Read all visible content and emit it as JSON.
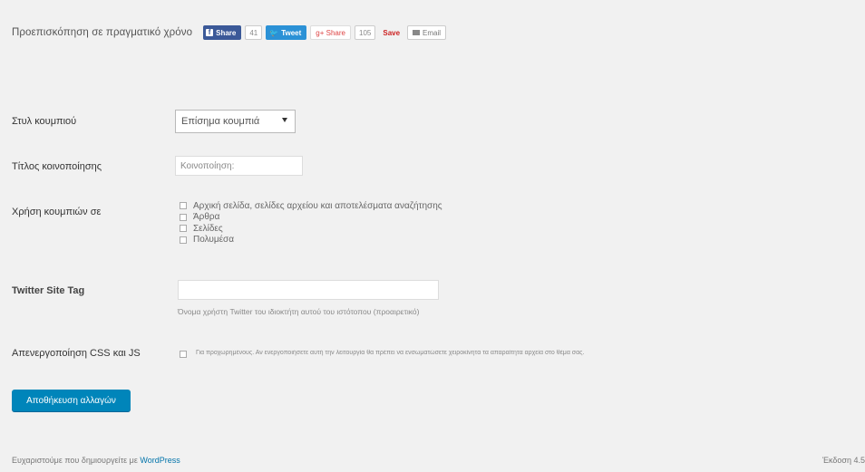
{
  "preview": {
    "label": "Προεπισκόπηση σε πραγματικό χρόνο",
    "buttons": {
      "facebook_label": "Share",
      "facebook_count": "41",
      "twitter_label": "Tweet",
      "gplus_label": "Share",
      "gplus_count": "105",
      "pinterest_label": "Save",
      "email_label": "Email"
    }
  },
  "fields": {
    "button_style": {
      "label": "Στυλ κουμπιού",
      "value": "Επίσημα κουμπιά"
    },
    "button_title": {
      "label": "Τίτλος κοινοποίησης",
      "value": "Κοινοποίηση:"
    },
    "button_usage": {
      "label": "Χρήση κουμπιών σε",
      "options": [
        "Αρχική σελίδα, σελίδες αρχείου και αποτελέσματα αναζήτησης",
        "Άρθρα",
        "Σελίδες",
        "Πολυμέσα"
      ]
    },
    "twitter_tag": {
      "label": "Twitter Site Tag",
      "value": "",
      "description": "Όνομα χρήστη Twitter του ιδιοκτήτη αυτού του ιστότοπου (προαιρετικό)"
    },
    "disable_css_js": {
      "label": "Απενεργοποίηση CSS και JS",
      "description": "Για προχωρημένους. Αν ενεργοποιήσετε αυτή την λειτουργία θα πρέπει να ενσωματώσετε χειροκίνητα τα απαραίτητα αρχεία στο θέμα σας."
    }
  },
  "save_button": "Αποθήκευση αλλαγών",
  "footer": {
    "thanks_text": "Ευχαριστούμε που δημιουργείτε με ",
    "wordpress_link": "WordPress",
    "version": "Έκδοση 4.5"
  },
  "colors": {
    "primary_button": "#0085ba",
    "facebook": "#3b5998",
    "twitter": "#2b91d6",
    "link": "#0073aa"
  }
}
